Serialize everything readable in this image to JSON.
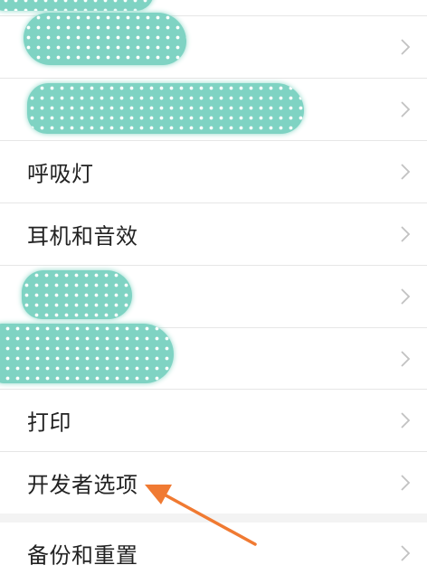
{
  "settings_list": {
    "items": [
      {
        "label": "",
        "redacted": true
      },
      {
        "label": "",
        "redacted": true
      },
      {
        "label": "呼吸灯"
      },
      {
        "label": "耳机和音效"
      },
      {
        "label": "",
        "redacted": true
      },
      {
        "label": "",
        "redacted": true
      },
      {
        "label": "打印"
      },
      {
        "label": "开发者选项"
      },
      {
        "label": "备份和重置"
      }
    ]
  },
  "colors": {
    "redaction_fill": "#7fd3c3",
    "annotation_arrow": "#f07a32",
    "chevron": "#c2c2c2",
    "divider": "#e6e6e6"
  },
  "icons": {
    "chevron": "chevron-right-icon",
    "annotation": "arrow-annotation-icon"
  }
}
